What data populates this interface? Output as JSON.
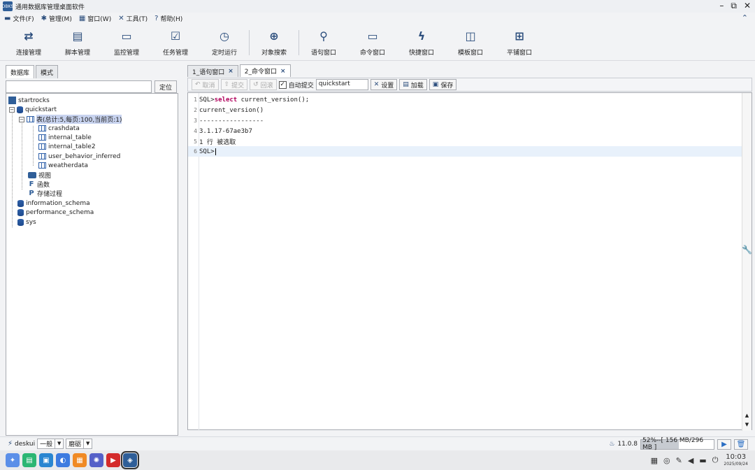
{
  "window": {
    "title": "通用数据库管理桌面软件",
    "logo_text": "DBKS"
  },
  "menu": [
    {
      "label": "文件(F)",
      "icon": "folder-icon"
    },
    {
      "label": "管理(M)",
      "icon": "gear-icon"
    },
    {
      "label": "窗口(W)",
      "icon": "windows-icon"
    },
    {
      "label": "工具(T)",
      "icon": "tools-icon"
    },
    {
      "label": "帮助(H)",
      "icon": "help-icon"
    }
  ],
  "toolbar": [
    {
      "label": "连接管理",
      "icon": "connect-icon"
    },
    {
      "label": "脚本管理",
      "icon": "script-icon"
    },
    {
      "label": "监控管理",
      "icon": "monitor-icon"
    },
    {
      "label": "任务管理",
      "icon": "task-icon"
    },
    {
      "label": "定时运行",
      "icon": "clock-icon"
    },
    {
      "label": "对象搜索",
      "icon": "object-search-icon"
    },
    {
      "label": "语句窗口",
      "icon": "search-icon"
    },
    {
      "label": "命令窗口",
      "icon": "terminal-icon"
    },
    {
      "label": "快捷窗口",
      "icon": "bolt-icon"
    },
    {
      "label": "模板窗口",
      "icon": "template-icon"
    },
    {
      "label": "平铺窗口",
      "icon": "tile-icon"
    }
  ],
  "left_panel": {
    "tabs": [
      "数据库",
      "模式"
    ],
    "locate_label": "定位",
    "tree": {
      "root": "startrocks",
      "database": "quickstart",
      "tables_node": "表(总计:5,每页:100,当前页:1)",
      "tables": [
        "crashdata",
        "internal_table",
        "internal_table2",
        "user_behavior_inferred",
        "weatherdata"
      ],
      "views": "视图",
      "functions": "函数",
      "procedures": "存储过程",
      "other_dbs": [
        "information_schema",
        "performance_schema",
        "sys"
      ]
    }
  },
  "editor": {
    "tabs": [
      {
        "label": "1_语句窗口"
      },
      {
        "label": "2_命令窗口"
      }
    ],
    "buttons": {
      "cancel": "取消",
      "submit": "提交",
      "rollback": "回滚",
      "autocommit": "自动提交",
      "settings": "设置",
      "load": "加载",
      "save": "保存"
    },
    "database_value": "quickstart",
    "lines": [
      {
        "n": "1",
        "prefix": "SQL>",
        "kw": "select",
        "rest": " current_version();"
      },
      {
        "n": "2",
        "prefix": "current_version()",
        "kw": "",
        "rest": ""
      },
      {
        "n": "3",
        "prefix": "-----------------",
        "kw": "",
        "rest": ""
      },
      {
        "n": "4",
        "prefix": "3.1.17-67ae3b7",
        "kw": "",
        "rest": ""
      },
      {
        "n": "5",
        "prefix": "1 行 被选取",
        "kw": "",
        "rest": ""
      },
      {
        "n": "6",
        "prefix": "SQL>",
        "kw": "",
        "rest": ""
      }
    ]
  },
  "status": {
    "connection": "deskui",
    "mode": "一般",
    "style": "磨砺",
    "version": "11.0.8",
    "memory": "52%--[ 156 MB/296 MB ]",
    "memory_fraction": 0.52
  },
  "taskbar": {
    "time": "10:03",
    "date": "2025/09/24"
  },
  "colors": {
    "accent": "#2b4d7c",
    "keyword": "#b0005c",
    "selection": "#c8d3ef",
    "current_line": "#e8f1fb"
  }
}
